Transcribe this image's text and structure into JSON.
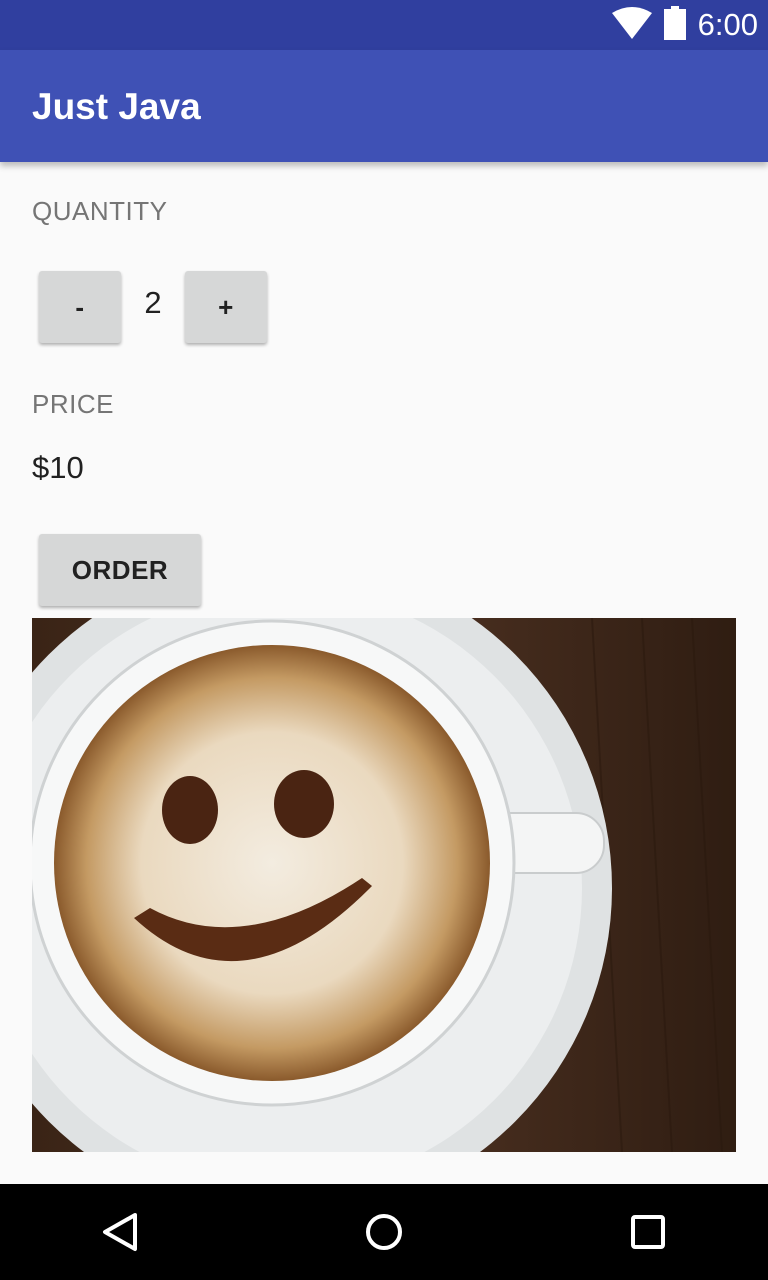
{
  "status_bar": {
    "time": "6:00",
    "wifi_icon": "wifi-icon",
    "battery_icon": "battery-icon"
  },
  "app_bar": {
    "title": "Just Java"
  },
  "quantity": {
    "label": "QUANTITY",
    "decrement_label": "-",
    "value": "2",
    "increment_label": "+"
  },
  "price": {
    "label": "PRICE",
    "value": "$10"
  },
  "order": {
    "button_label": "ORDER"
  },
  "image": {
    "subject": "coffee-latte-art-smiley-image"
  },
  "nav_bar": {
    "back_icon": "back-triangle-icon",
    "home_icon": "home-circle-icon",
    "recents_icon": "recents-square-icon"
  },
  "colors": {
    "status_bar": "#303f9f",
    "app_bar": "#3f51b5",
    "button": "#d6d7d7",
    "background": "#fafafa"
  }
}
